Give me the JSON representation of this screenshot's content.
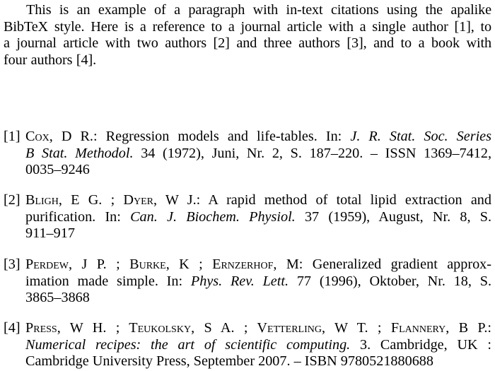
{
  "paragraph": {
    "lines": [
      "This is an example of a paragraph with in-text citations using the apalike",
      "BibTeX style. Here is a reference to a journal article with a single author [1], to",
      "a journal article with two authors [2] and three authors [3], and to a book with",
      "four authors [4]."
    ]
  },
  "bibliography": [
    {
      "label": "[1]",
      "authors": [
        "Cox, D R."
      ],
      "title": "Regression models and life-tables.",
      "in_prefix": "In:",
      "journal": "J. R. Stat. Soc. Series B Stat. Methodol.",
      "details": "34 (1972), Juni, Nr. 2, S. 187–220. – ISSN 1369–7412, 0035–9246",
      "lines": [
        [
          {
            "t": "C",
            "s": ""
          },
          {
            "t": "ox",
            "s": "sc"
          },
          {
            "t": ", D R.:  Regression models and life-tables.  In: ",
            "s": ""
          },
          {
            "t": "J. R. Stat. Soc. Series",
            "s": "it"
          }
        ],
        [
          {
            "t": "B Stat. Methodol.",
            "s": "it"
          },
          {
            "t": "  34 (1972), Juni, Nr. 2, S. 187–220. –  ISSN 1369–7412,",
            "s": ""
          }
        ],
        [
          {
            "t": "0035–9246",
            "s": ""
          }
        ]
      ]
    },
    {
      "label": "[2]",
      "authors": [
        "Bligh, E G.",
        "Dyer, W J."
      ],
      "title": "A rapid method of total lipid extraction and purification.",
      "in_prefix": "In:",
      "journal": "Can. J. Biochem. Physiol.",
      "details": "37 (1959), August, Nr. 8, S. 911–917",
      "lines": [
        [
          {
            "t": "B",
            "s": ""
          },
          {
            "t": "ligh",
            "s": "sc"
          },
          {
            "t": ", E G. ; D",
            "s": ""
          },
          {
            "t": "yer",
            "s": "sc"
          },
          {
            "t": ", W J.:  A rapid method of total lipid extraction and",
            "s": ""
          }
        ],
        [
          {
            "t": "purification.  In:  ",
            "s": ""
          },
          {
            "t": "Can. J. Biochem. Physiol.",
            "s": "it"
          },
          {
            "t": "  37 (1959), August, Nr. 8, S.",
            "s": ""
          }
        ],
        [
          {
            "t": "911–917",
            "s": ""
          }
        ]
      ]
    },
    {
      "label": "[3]",
      "authors": [
        "Perdew, J P.",
        "Burke, K",
        "Ernzerhof, M"
      ],
      "title": "Generalized gradient approximation made simple.",
      "in_prefix": "In:",
      "journal": "Phys. Rev. Lett.",
      "details": "77 (1996), Oktober, Nr. 18, S. 3865–3868",
      "lines": [
        [
          {
            "t": "P",
            "s": ""
          },
          {
            "t": "erdew",
            "s": "sc"
          },
          {
            "t": ", J P. ; B",
            "s": ""
          },
          {
            "t": "urke",
            "s": "sc"
          },
          {
            "t": ", K ; E",
            "s": ""
          },
          {
            "t": "rnzerhof",
            "s": "sc"
          },
          {
            "t": ", M: Generalized gradient approx-",
            "s": ""
          }
        ],
        [
          {
            "t": "imation made simple.  In:  ",
            "s": ""
          },
          {
            "t": "Phys. Rev. Lett.",
            "s": "it"
          },
          {
            "t": "  77 (1996), Oktober, Nr. 18, S.",
            "s": ""
          }
        ],
        [
          {
            "t": "3865–3868",
            "s": ""
          }
        ]
      ]
    },
    {
      "label": "[4]",
      "authors": [
        "Press, W H.",
        "Teukolsky, S A.",
        "Vetterling, W T.",
        "Flannery, B P."
      ],
      "title": "Numerical recipes: the art of scientific computing.",
      "edition": "3.",
      "publisher": "Cambridge, UK : Cambridge University Press, September 2007.",
      "details": "– ISBN 9780521880688",
      "lines": [
        [
          {
            "t": "P",
            "s": ""
          },
          {
            "t": "ress",
            "s": "sc"
          },
          {
            "t": ", W H. ; T",
            "s": ""
          },
          {
            "t": "eukolsky",
            "s": "sc"
          },
          {
            "t": ", S A. ; V",
            "s": ""
          },
          {
            "t": "etterling",
            "s": "sc"
          },
          {
            "t": ", W T. ; F",
            "s": ""
          },
          {
            "t": "lannery",
            "s": "sc"
          },
          {
            "t": ", B P.:",
            "s": ""
          }
        ],
        [
          {
            "t": "Numerical recipes: the art of scientific computing.",
            "s": "it"
          },
          {
            "t": "  3.  Cambridge, UK :",
            "s": ""
          }
        ],
        [
          {
            "t": "Cambridge University Press, September 2007. – ISBN 9780521880688",
            "s": ""
          }
        ]
      ]
    }
  ]
}
